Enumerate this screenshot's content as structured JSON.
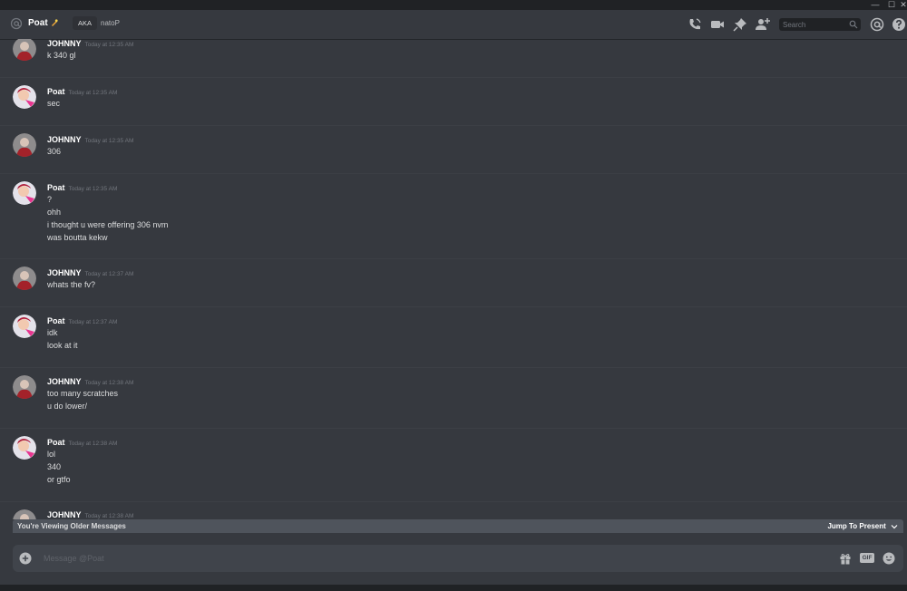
{
  "window": {
    "controls": [
      "—",
      "☐",
      "✕"
    ]
  },
  "header": {
    "at_icon": "at-icon",
    "name": "Poat",
    "aka_label": "AKA",
    "nickname": "natoP",
    "icons": [
      "phone-call-icon",
      "video-icon",
      "pin-icon",
      "add-friend-icon",
      "mention-icon",
      "help-icon"
    ],
    "search_placeholder": "Search"
  },
  "messages": [
    {
      "author": "JOHNNY",
      "timestamp": "Today at 12:35 AM",
      "lines": [
        "k 340 gl"
      ]
    },
    {
      "author": "Poat",
      "timestamp": "Today at 12:35 AM",
      "lines": [
        "sec"
      ]
    },
    {
      "author": "JOHNNY",
      "timestamp": "Today at 12:35 AM",
      "lines": [
        "306"
      ]
    },
    {
      "author": "Poat",
      "timestamp": "Today at 12:35 AM",
      "lines": [
        "?",
        "ohh",
        "i thought u were offering 306 nvm",
        "was boutta kekw"
      ]
    },
    {
      "author": "JOHNNY",
      "timestamp": "Today at 12:37 AM",
      "lines": [
        "whats the fv?"
      ]
    },
    {
      "author": "Poat",
      "timestamp": "Today at 12:37 AM",
      "lines": [
        "idk",
        "look at it"
      ]
    },
    {
      "author": "JOHNNY",
      "timestamp": "Today at 12:38 AM",
      "lines": [
        "too many scratches",
        "u do lower/"
      ]
    },
    {
      "author": "Poat",
      "timestamp": "Today at 12:38 AM",
      "lines": [
        "lol",
        "340",
        "or gtfo"
      ]
    },
    {
      "author": "JOHNNY",
      "timestamp": "Today at 12:38 AM",
      "lines": []
    }
  ],
  "older_bar": {
    "text": "You're Viewing Older Messages",
    "jump_label": "Jump To Present"
  },
  "composer": {
    "placeholder": "Message @Poat",
    "icons": [
      "add-attachment-icon",
      "gift-icon",
      "gif-icon",
      "emoji-icon"
    ],
    "gif_label": "GIF"
  },
  "colors": {
    "background": "#36393f",
    "header_text": "#ffffff",
    "timestamp": "#72767d",
    "bar": "#4f545c"
  }
}
